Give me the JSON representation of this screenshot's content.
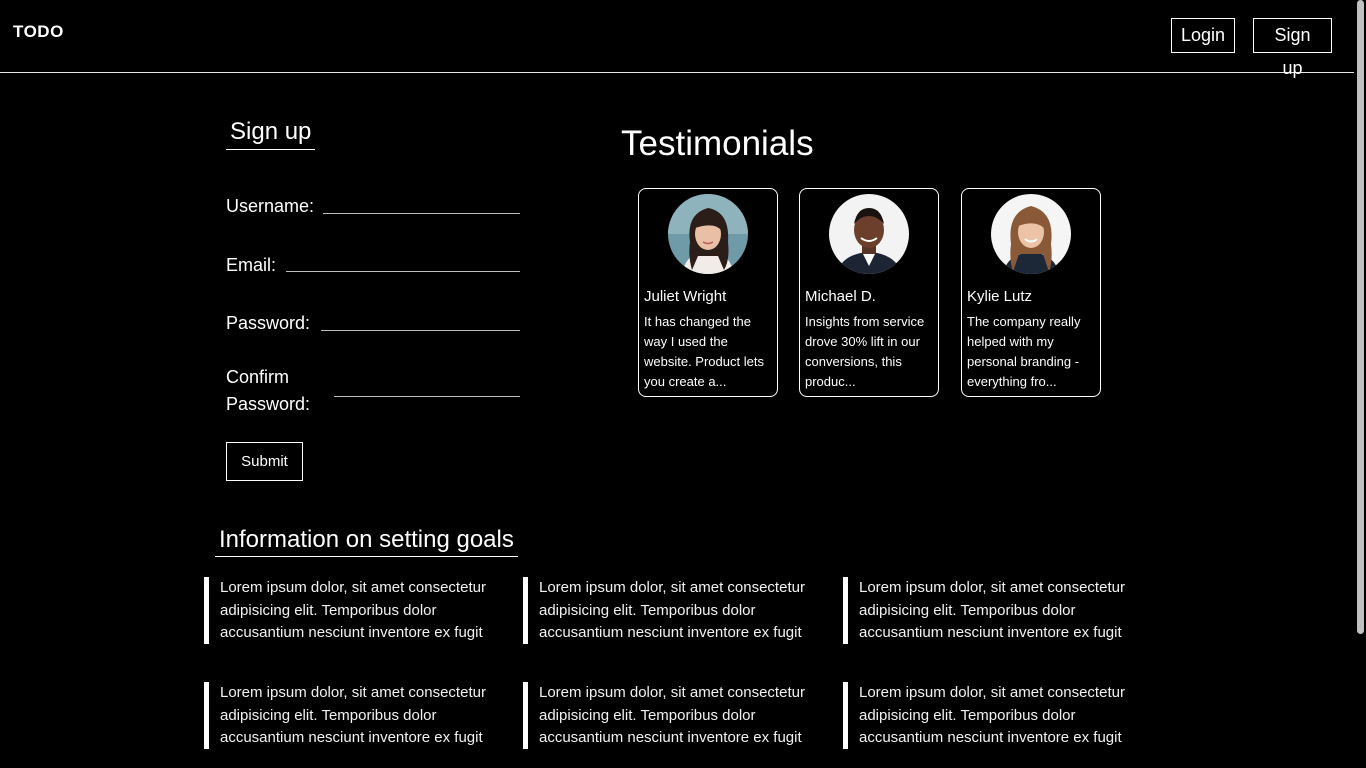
{
  "header": {
    "logo": "TODO",
    "login_label": "Login",
    "signup_label": "Sign up"
  },
  "signup": {
    "title": "Sign up",
    "fields": [
      {
        "label": "Username:",
        "value": ""
      },
      {
        "label": "Email:",
        "value": ""
      },
      {
        "label": "Password:",
        "value": ""
      },
      {
        "label_line1": "Confirm",
        "label_line2": "Password:",
        "value": ""
      }
    ],
    "submit_label": "Submit"
  },
  "testimonials": {
    "title": "Testimonials",
    "cards": [
      {
        "name": "Juliet Wright",
        "text": "It has changed the way I used the website. Product lets you create a..."
      },
      {
        "name": "Michael D.",
        "text": "Insights from service drove 30% lift in our conversions, this produc..."
      },
      {
        "name": "Kylie Lutz",
        "text": "The company really helped with my personal branding - everything fro..."
      }
    ]
  },
  "info": {
    "title": "Information on setting goals",
    "blocks": [
      "Lorem ipsum dolor, sit amet consectetur adipisicing elit. Temporibus dolor accusantium nesciunt inventore ex fugit",
      "Lorem ipsum dolor, sit amet consectetur adipisicing elit. Temporibus dolor accusantium nesciunt inventore ex fugit",
      "Lorem ipsum dolor, sit amet consectetur adipisicing elit. Temporibus dolor accusantium nesciunt inventore ex fugit",
      "Lorem ipsum dolor, sit amet consectetur adipisicing elit. Temporibus dolor accusantium nesciunt inventore ex fugit",
      "Lorem ipsum dolor, sit amet consectetur adipisicing elit. Temporibus dolor accusantium nesciunt inventore ex fugit",
      "Lorem ipsum dolor, sit amet consectetur adipisicing elit. Temporibus dolor accusantium nesciunt inventore ex fugit"
    ]
  },
  "colors": {
    "background": "#000000",
    "text": "#ffffff",
    "border": "#ffffff"
  }
}
